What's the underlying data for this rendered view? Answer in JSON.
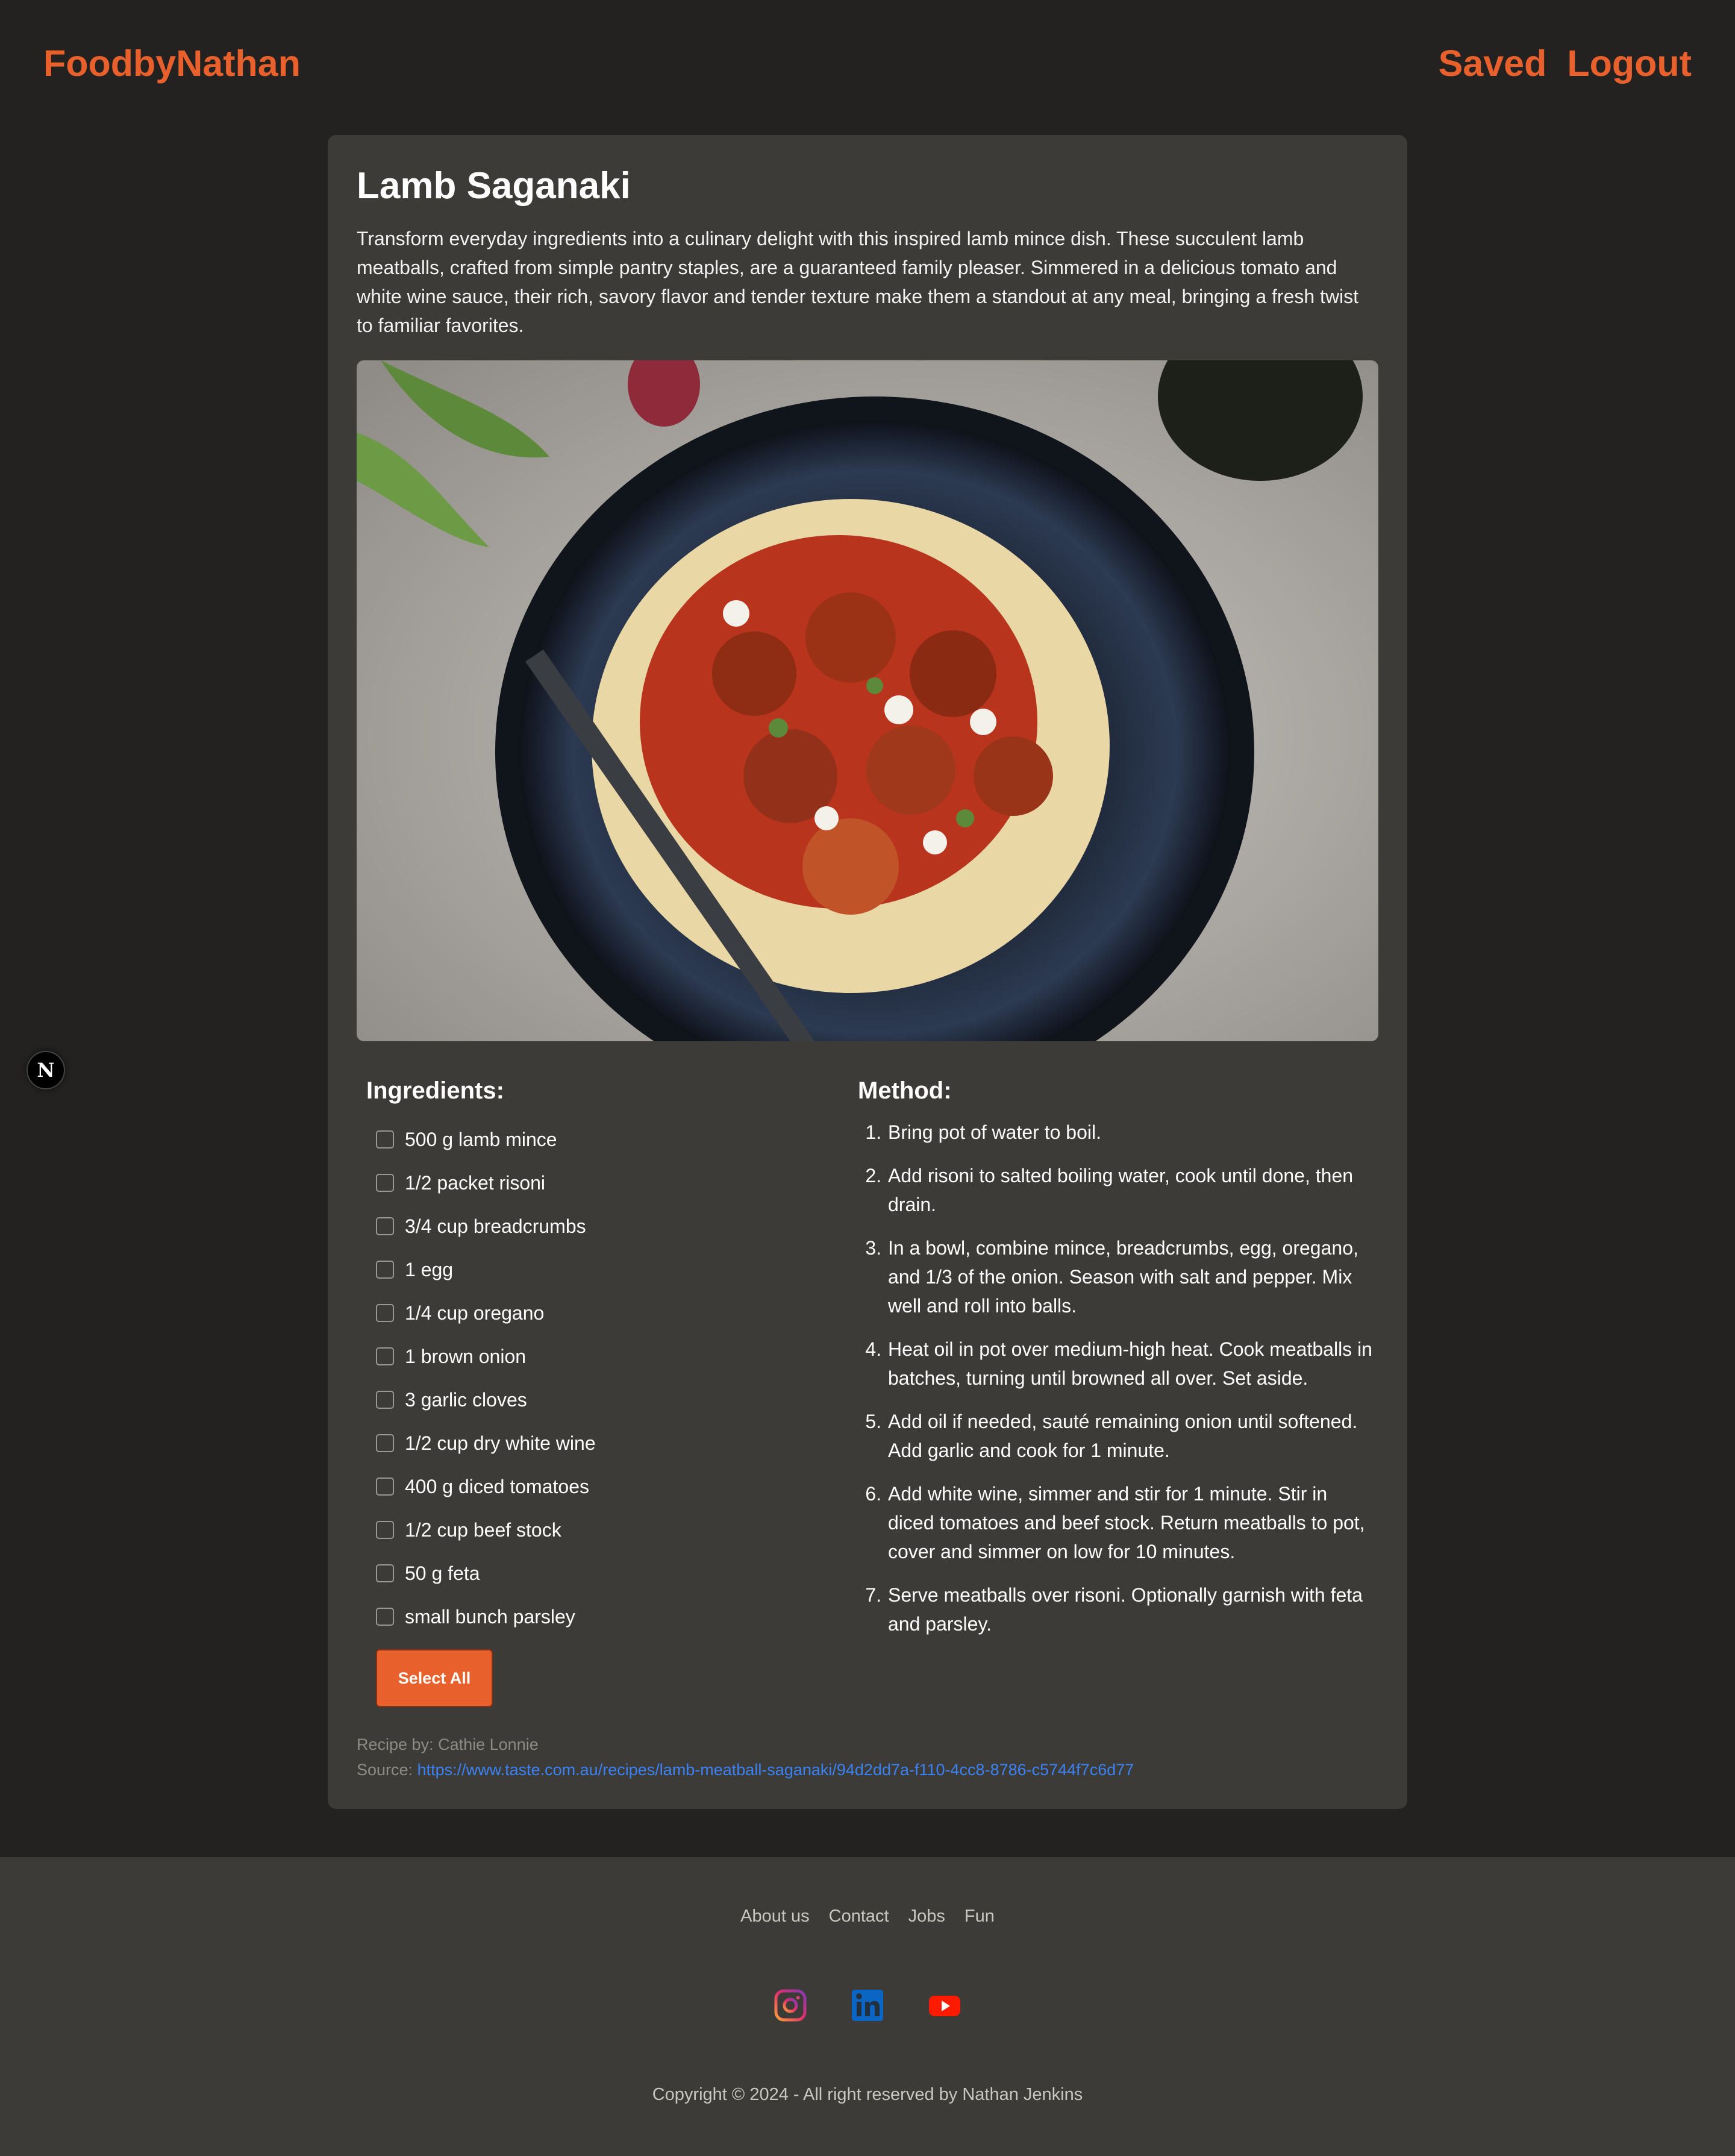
{
  "header": {
    "brand": "FoodbyNathan",
    "nav": [
      "Saved",
      "Logout"
    ]
  },
  "recipe": {
    "title": "Lamb Saganaki",
    "description": "Transform everyday ingredients into a culinary delight with this inspired lamb mince dish. These succulent lamb meatballs, crafted from simple pantry staples, are a guaranteed family pleaser. Simmered in a delicious tomato and white wine sauce, their rich, savory flavor and tender texture make them a standout at any meal, bringing a fresh twist to familiar favorites.",
    "ingredients_title": "Ingredients:",
    "ingredients": [
      "500 g lamb mince",
      "1/2 packet risoni",
      "3/4 cup breadcrumbs",
      "1 egg",
      "1/4 cup oregano",
      "1 brown onion",
      "3 garlic cloves",
      "1/2 cup dry white wine",
      "400 g diced tomatoes",
      "1/2 cup beef stock",
      "50 g feta",
      "small bunch parsley"
    ],
    "select_all_label": "Select All",
    "method_title": "Method:",
    "method": [
      "Bring pot of water to boil.",
      "Add risoni to salted boiling water, cook until done, then drain.",
      "In a bowl, combine mince, breadcrumbs, egg, oregano, and 1/3 of the onion. Season with salt and pepper. Mix well and roll into balls.",
      "Heat oil in pot over medium-high heat. Cook meatballs in batches, turning until browned all over. Set aside.",
      "Add oil if needed, sauté remaining onion until softened. Add garlic and cook for 1 minute.",
      "Add white wine, simmer and stir for 1 minute. Stir in diced tomatoes and beef stock. Return meatballs to pot, cover and simmer on low for 10 minutes.",
      "Serve meatballs over risoni. Optionally garnish with feta and parsley."
    ],
    "author_label": "Recipe by:",
    "author": "Cathie Lonnie",
    "source_label": "Source:",
    "source_url": "https://www.taste.com.au/recipes/lamb-meatball-saganaki/94d2dd7a-f110-4cc8-8786-c5744f7c6d77"
  },
  "dev_badge": "N",
  "footer": {
    "links": [
      "About us",
      "Contact",
      "Jobs",
      "Fun"
    ],
    "socials": [
      "instagram-icon",
      "linkedin-icon",
      "youtube-icon"
    ],
    "copyright": "Copyright © 2024 - All right reserved by Nathan Jenkins"
  },
  "colors": {
    "background": "#232221",
    "card": "#3d3b37",
    "accent": "#e8602c",
    "link": "#3b82f6"
  }
}
